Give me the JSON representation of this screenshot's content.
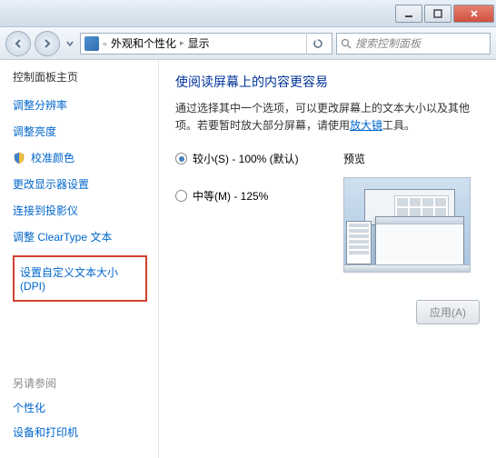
{
  "breadcrumb": {
    "level1": "外观和个性化",
    "level2": "显示"
  },
  "search": {
    "placeholder": "搜索控制面板"
  },
  "sidebar": {
    "home": "控制面板主页",
    "items": [
      {
        "label": "调整分辨率"
      },
      {
        "label": "调整亮度"
      },
      {
        "label": "校准颜色",
        "shield": true
      },
      {
        "label": "更改显示器设置"
      },
      {
        "label": "连接到投影仪"
      },
      {
        "label": "调整 ClearType 文本"
      },
      {
        "label": "设置自定义文本大小(DPI)",
        "highlighted": true
      }
    ],
    "footer_title": "另请参阅",
    "footer_links": [
      "个性化",
      "设备和打印机"
    ]
  },
  "main": {
    "title": "使阅读屏幕上的内容更容易",
    "desc_before": "通过选择其中一个选项，可以更改屏幕上的文本大小以及其他项。若要暂时放大部分屏幕，请使用",
    "desc_link": "放大镜",
    "desc_after": "工具。",
    "options": [
      {
        "label": "较小(S) - 100% (默认)",
        "checked": true
      },
      {
        "label": "中等(M) - 125%",
        "checked": false
      }
    ],
    "preview_label": "预览",
    "apply": "应用(A)"
  }
}
